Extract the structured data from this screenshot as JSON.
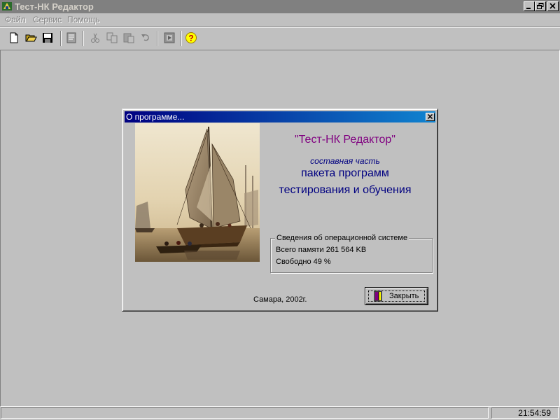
{
  "window": {
    "title": "Тест-НК Редактор"
  },
  "menu": {
    "items": [
      "Файл",
      "Сервис",
      "Помощь"
    ]
  },
  "toolbar": {
    "buttons": [
      "new-file-icon",
      "open-folder-icon",
      "save-icon",
      "preview-icon",
      "cut-icon",
      "copy-icon",
      "paste-icon",
      "undo-icon",
      "run-icon",
      "help-icon"
    ]
  },
  "dialog": {
    "title": "О программе...",
    "product_name": "\"Тест-НК Редактор\"",
    "part_of": "составная часть",
    "suite_line1": "пакета программ",
    "suite_line2": "тестирования и обучения",
    "sysinfo": {
      "legend": "Сведения об операционной системе",
      "total_memory": "Всего памяти 261 564 KB",
      "free": "Свободно 49 %"
    },
    "footer": "Самара, 2002г.",
    "close_label": "Закрыть"
  },
  "status": {
    "time": "21:54:59"
  },
  "colors": {
    "caption_start": "#000080",
    "caption_end": "#1084d0",
    "product_name": "#800080",
    "suite_text": "#000080"
  }
}
